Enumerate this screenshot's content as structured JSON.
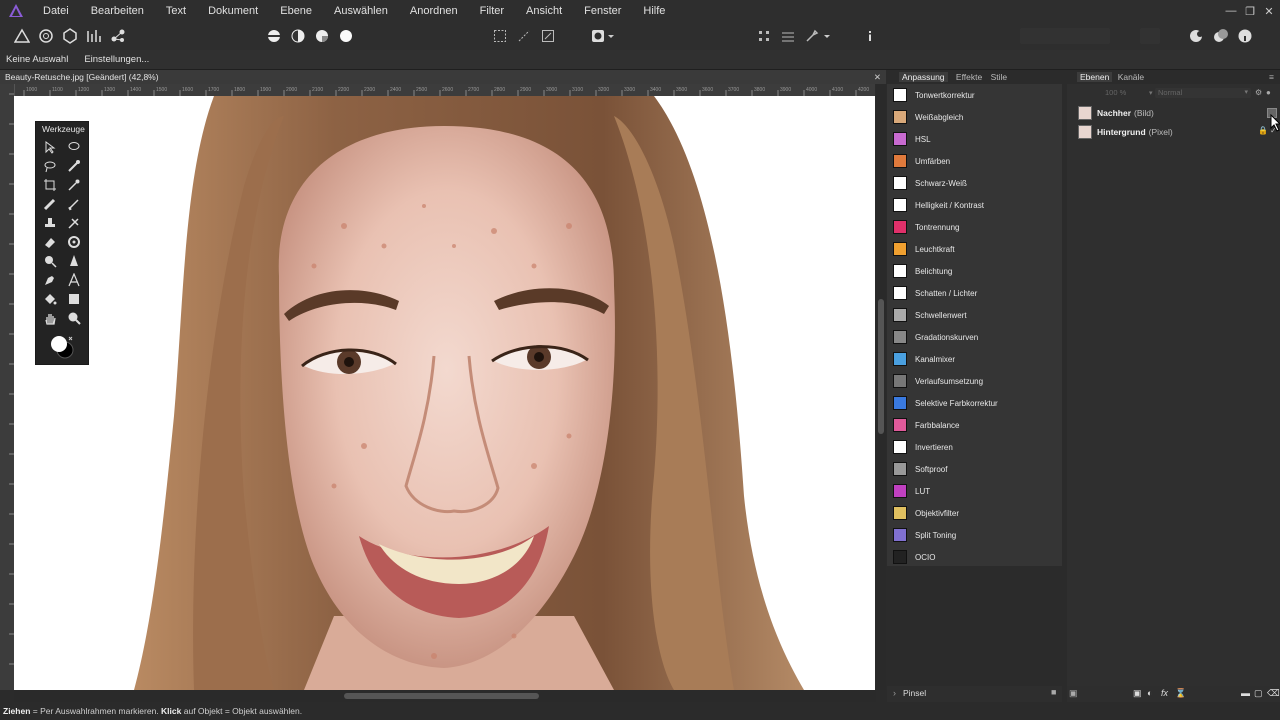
{
  "menubar": {
    "items": [
      "Datei",
      "Bearbeiten",
      "Text",
      "Dokument",
      "Ebene",
      "Auswählen",
      "Anordnen",
      "Filter",
      "Ansicht",
      "Fenster",
      "Hilfe"
    ]
  },
  "contextbar": {
    "selection_label": "Keine Auswahl",
    "settings_label": "Einstellungen..."
  },
  "document": {
    "tab_title": "Beauty-Retusche.jpg [Geändert] (42,8%)",
    "ruler_ticks": [
      "1000",
      "1100",
      "1200",
      "1300",
      "1400",
      "1500",
      "1600",
      "1700",
      "1800",
      "1900",
      "2000",
      "2100",
      "2200",
      "2300",
      "2400",
      "2500",
      "2600",
      "2700",
      "2800",
      "2900",
      "3000",
      "3100",
      "3200",
      "3300",
      "3400",
      "3500",
      "3600",
      "3700",
      "3800",
      "3900",
      "4000",
      "4100",
      "4200"
    ]
  },
  "tools_panel": {
    "title": "Werkzeuge"
  },
  "adjustments_panel": {
    "tabs": [
      "Anpassung",
      "Effekte",
      "Stile"
    ],
    "items": [
      {
        "label": "Tonwertkorrektur",
        "color": "#ffffff"
      },
      {
        "label": "Weißabgleich",
        "color": "#d9a97a"
      },
      {
        "label": "HSL",
        "color": "#c86ad0"
      },
      {
        "label": "Umfärben",
        "color": "#e07a3c"
      },
      {
        "label": "Schwarz-Weiß",
        "color": "#ffffff"
      },
      {
        "label": "Helligkeit / Kontrast",
        "color": "#ffffff"
      },
      {
        "label": "Tontrennung",
        "color": "#e0306a"
      },
      {
        "label": "Leuchtkraft",
        "color": "#f0a030"
      },
      {
        "label": "Belichtung",
        "color": "#ffffff"
      },
      {
        "label": "Schatten / Lichter",
        "color": "#ffffff"
      },
      {
        "label": "Schwellenwert",
        "color": "#aaaaaa"
      },
      {
        "label": "Gradationskurven",
        "color": "#888888"
      },
      {
        "label": "Kanalmixer",
        "color": "#4aa0e0"
      },
      {
        "label": "Verlaufsumsetzung",
        "color": "#777777"
      },
      {
        "label": "Selektive Farbkorrektur",
        "color": "#3a7ae0"
      },
      {
        "label": "Farbbalance",
        "color": "#e05a9a"
      },
      {
        "label": "Invertieren",
        "color": "#ffffff"
      },
      {
        "label": "Softproof",
        "color": "#999999"
      },
      {
        "label": "LUT",
        "color": "#c040c0"
      },
      {
        "label": "Objektivfilter",
        "color": "#e0c060"
      },
      {
        "label": "Split Toning",
        "color": "#8070d0"
      },
      {
        "label": "OCIO",
        "color": "#222222"
      }
    ],
    "brush_label": "Pinsel"
  },
  "layers_panel": {
    "tabs": [
      "Ebenen",
      "Kanäle"
    ],
    "opacity": "100 %",
    "blend_mode": "Normal",
    "layers": [
      {
        "name": "Nachher",
        "kind": "(Bild)"
      },
      {
        "name": "Hintergrund",
        "kind": "(Pixel)"
      }
    ]
  },
  "statusbar": {
    "drag_key": "Ziehen",
    "drag_text": " = Per Auswahlrahmen markieren. ",
    "click_key": "Klick",
    "click_text": " auf Objekt = Objekt auswählen."
  }
}
